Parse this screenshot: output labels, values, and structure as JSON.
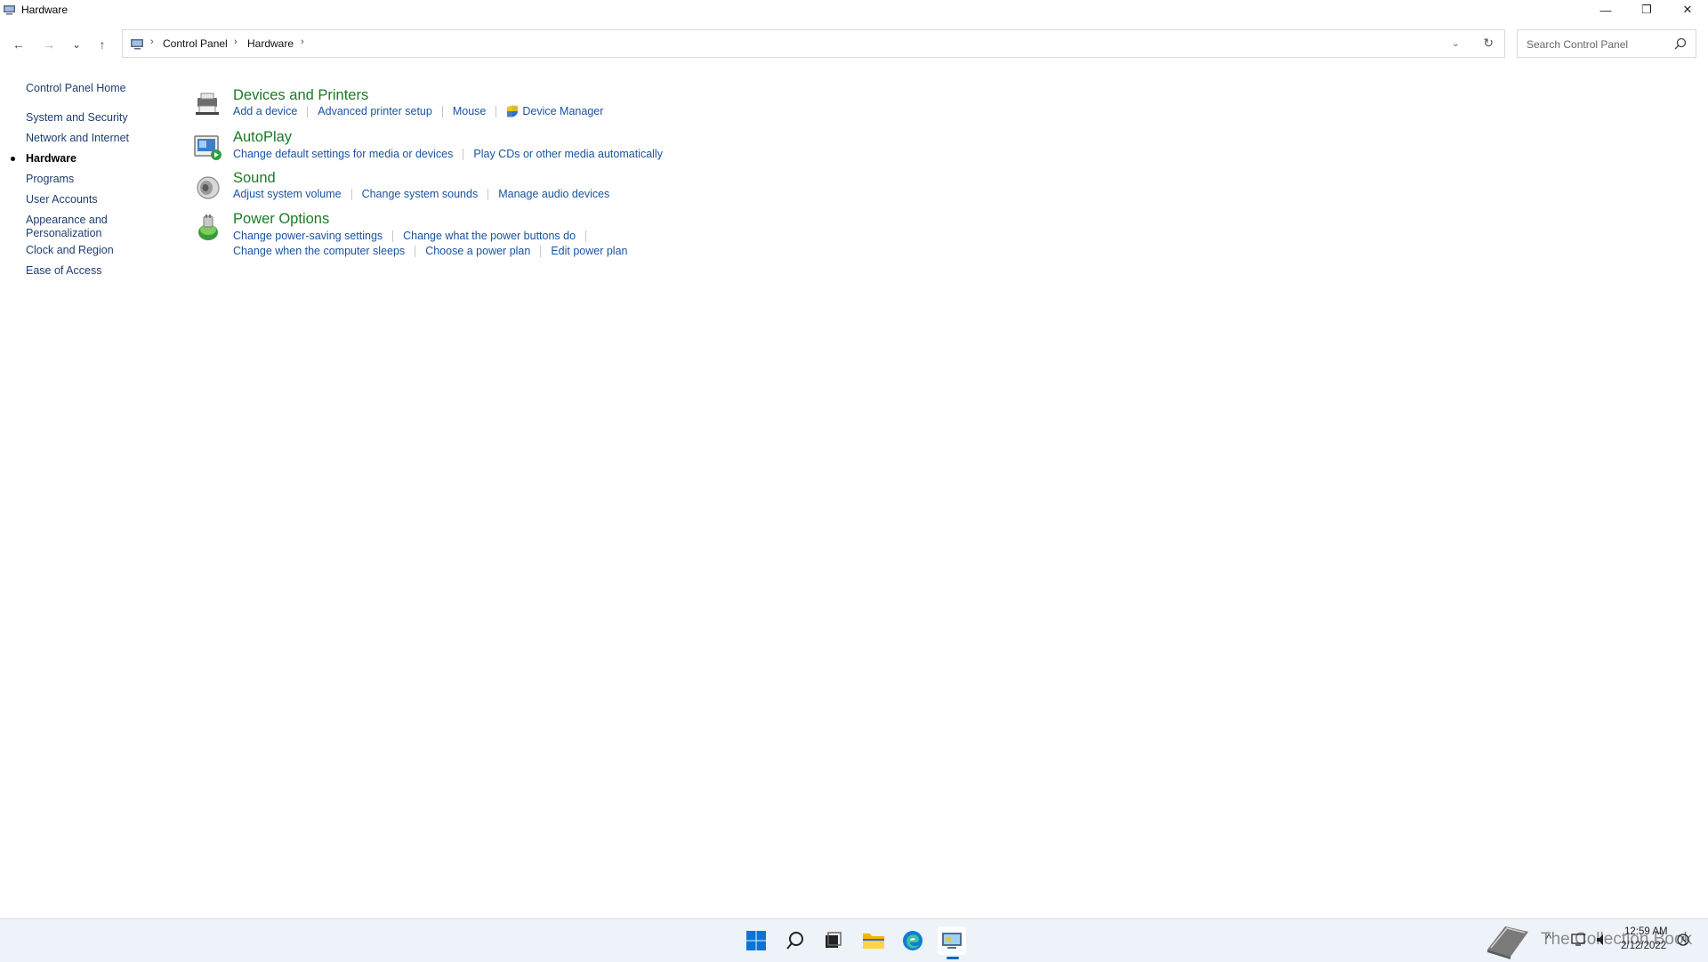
{
  "window": {
    "title": "Hardware",
    "minimize_glyph": "—",
    "maximize_glyph": "❐",
    "close_glyph": "✕"
  },
  "nav": {
    "back_glyph": "←",
    "forward_glyph": "→",
    "recent_glyph": "⌄",
    "up_glyph": "↑"
  },
  "address": {
    "breadcrumb": [
      "Control Panel",
      "Hardware"
    ],
    "separator": "›"
  },
  "search": {
    "placeholder": "Search Control Panel"
  },
  "sidebar": {
    "items": [
      {
        "label": "Control Panel Home"
      },
      {
        "label": "System and Security"
      },
      {
        "label": "Network and Internet"
      },
      {
        "label": "Hardware",
        "current": true
      },
      {
        "label": "Programs"
      },
      {
        "label": "User Accounts"
      },
      {
        "label": "Appearance and Personalization"
      },
      {
        "label": "Clock and Region"
      },
      {
        "label": "Ease of Access"
      }
    ]
  },
  "categories": [
    {
      "title": "Devices and Printers",
      "icon": "devices-printers-icon",
      "links": [
        [
          "Add a device",
          "Advanced printer setup",
          "Mouse",
          "Device Manager"
        ]
      ]
    },
    {
      "title": "AutoPlay",
      "icon": "autoplay-icon",
      "links": [
        [
          "Change default settings for media or devices",
          "Play CDs or other media automatically"
        ]
      ]
    },
    {
      "title": "Sound",
      "icon": "speaker-icon",
      "links": [
        [
          "Adjust system volume",
          "Change system sounds",
          "Manage audio devices"
        ]
      ]
    },
    {
      "title": "Power Options",
      "icon": "power-options-icon",
      "links": [
        [
          "Change power-saving settings",
          "Change what the power buttons do"
        ],
        [
          "Change when the computer sleeps",
          "Choose a power plan",
          "Edit power plan"
        ]
      ]
    }
  ],
  "taskbar": {
    "apps": [
      "start-icon",
      "search-icon",
      "task-view-icon",
      "file-explorer-icon",
      "edge-icon",
      "control-panel-icon"
    ],
    "tray": {
      "time": "12:59 AM",
      "date": "2/12/2022",
      "overflow_glyph": "^"
    },
    "watermark": "The Collection Book",
    "accent": "#0067c0"
  },
  "colors": {
    "link": "#1a53a0",
    "category_title": "#1a7a26",
    "sidebar_link": "#1e3e6e"
  }
}
